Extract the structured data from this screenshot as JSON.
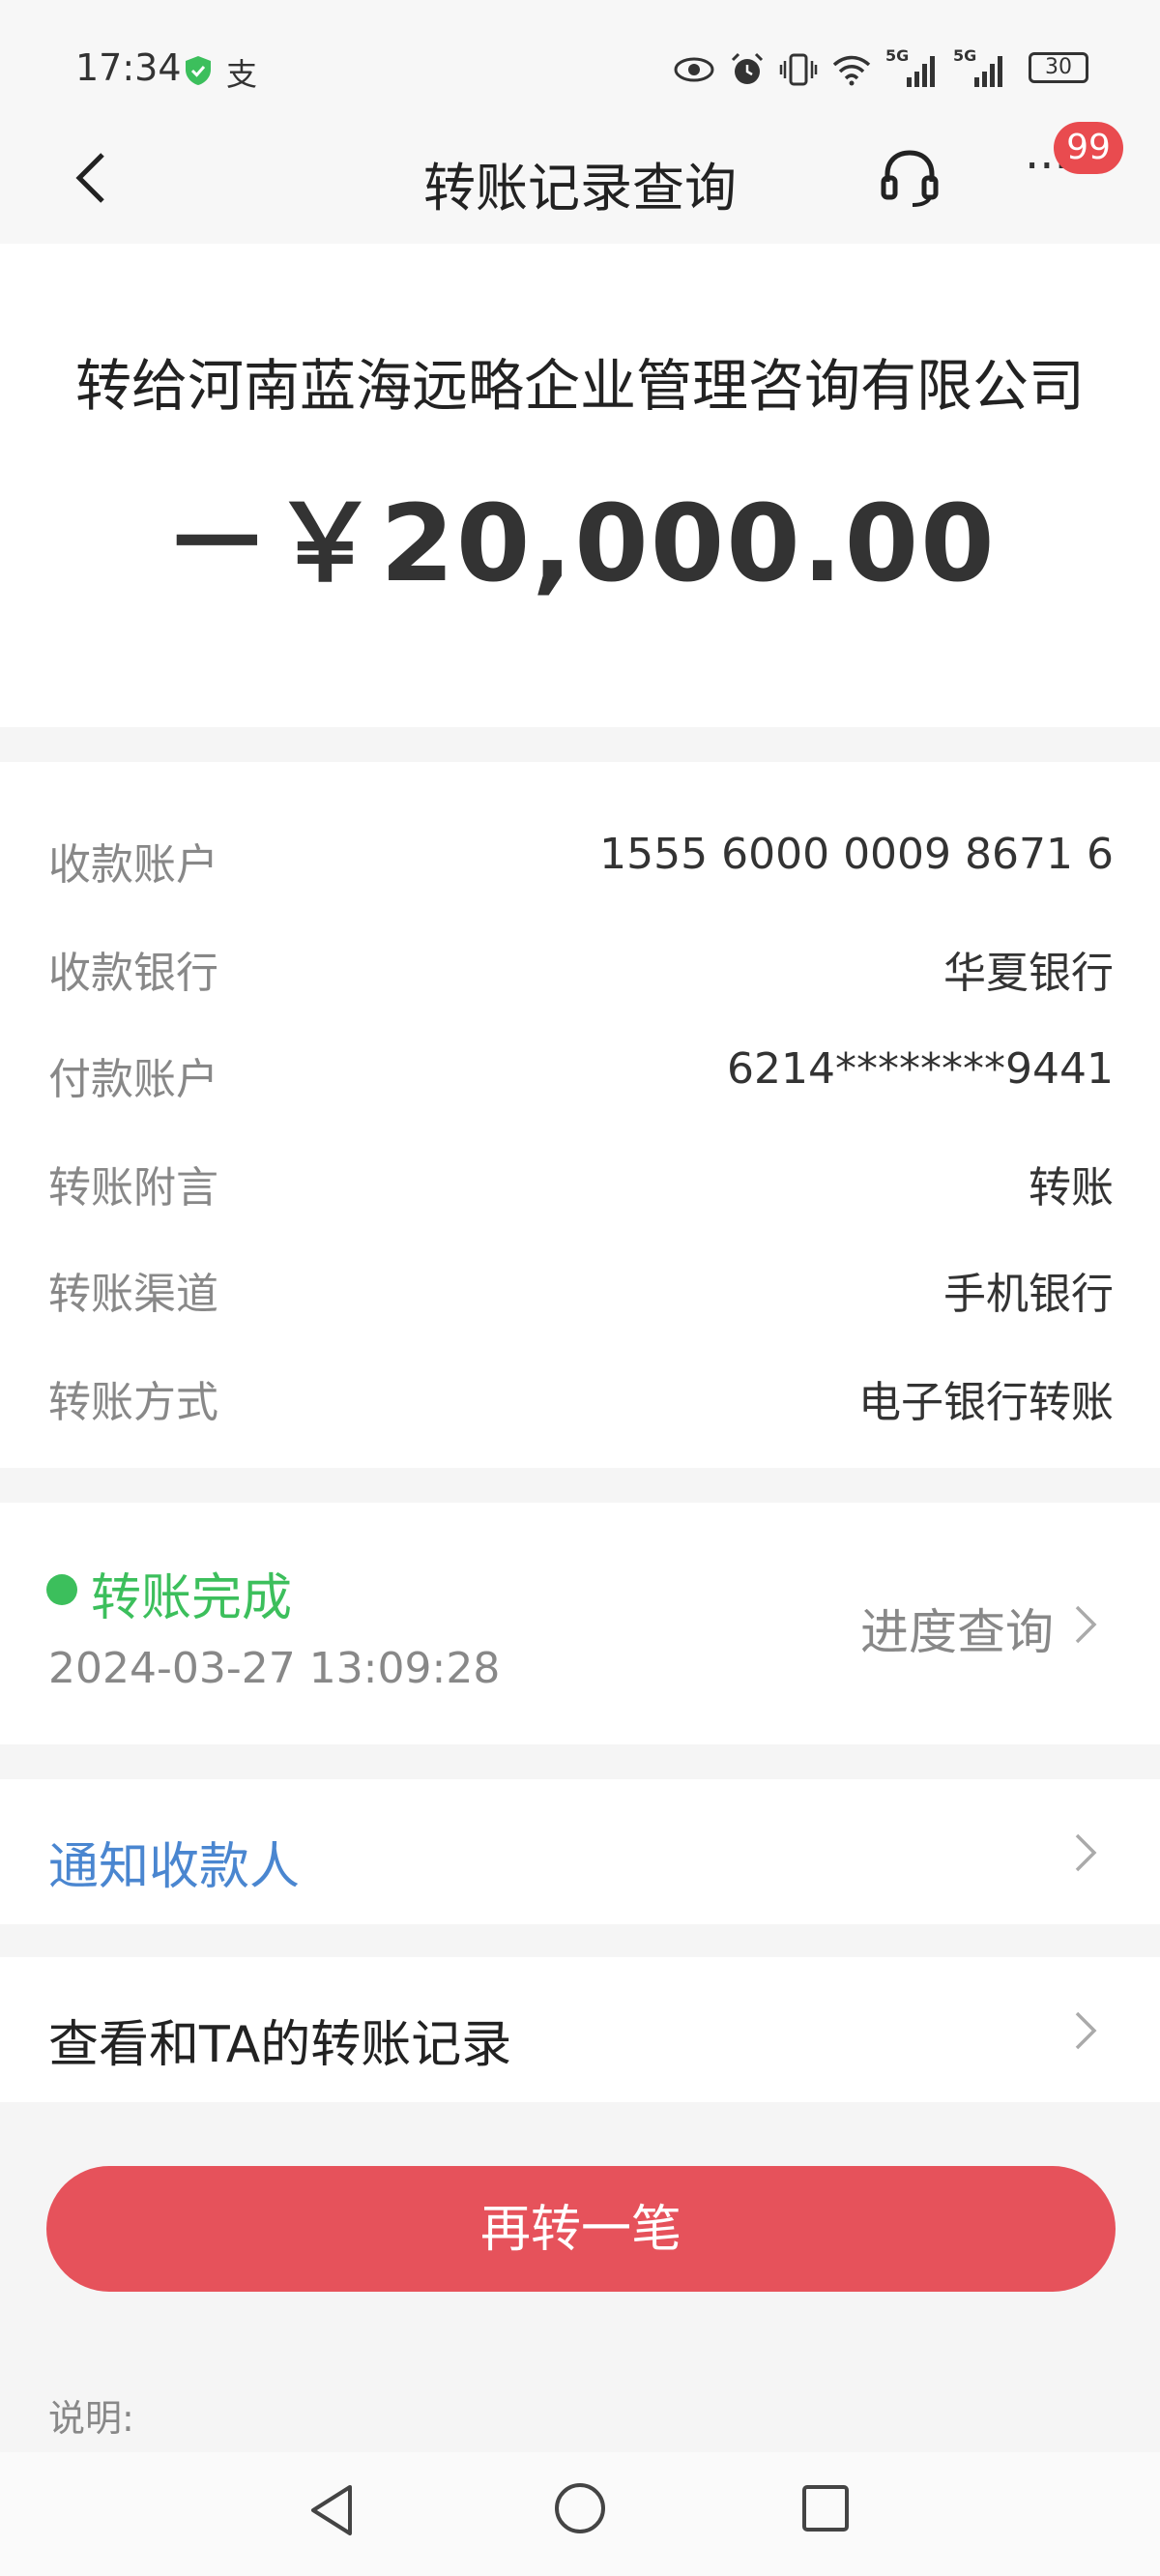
{
  "status_bar": {
    "time": "17:34",
    "pay_glyph": "支",
    "network_1": "5G",
    "network_2": "5G",
    "battery": "30"
  },
  "nav": {
    "title": "转账记录查询",
    "more_glyph": "···",
    "badge": "99"
  },
  "summary": {
    "payee": "转给河南蓝海远略企业管理咨询有限公司",
    "amount": "－￥20,000.00"
  },
  "details": [
    {
      "label": "收款账户",
      "value": "1555 6000 0009 8671 6"
    },
    {
      "label": "收款银行",
      "value": "华夏银行"
    },
    {
      "label": "付款账户",
      "value": "6214********9441"
    },
    {
      "label": "转账附言",
      "value": "转账"
    },
    {
      "label": "转账渠道",
      "value": "手机银行"
    },
    {
      "label": "转账方式",
      "value": "电子银行转账"
    }
  ],
  "status": {
    "text": "转账完成",
    "time": "2024-03-27 13:09:28",
    "progress_link": "进度查询",
    "color": "#3cbf5c"
  },
  "actions": {
    "notify": "通知收款人",
    "records": "查看和TA的转账记录",
    "again_button": "再转一笔"
  },
  "note": "说明:",
  "colors": {
    "accent_red": "#e6525b",
    "link_blue": "#4a86d0",
    "badge_red": "#e94b4f"
  }
}
